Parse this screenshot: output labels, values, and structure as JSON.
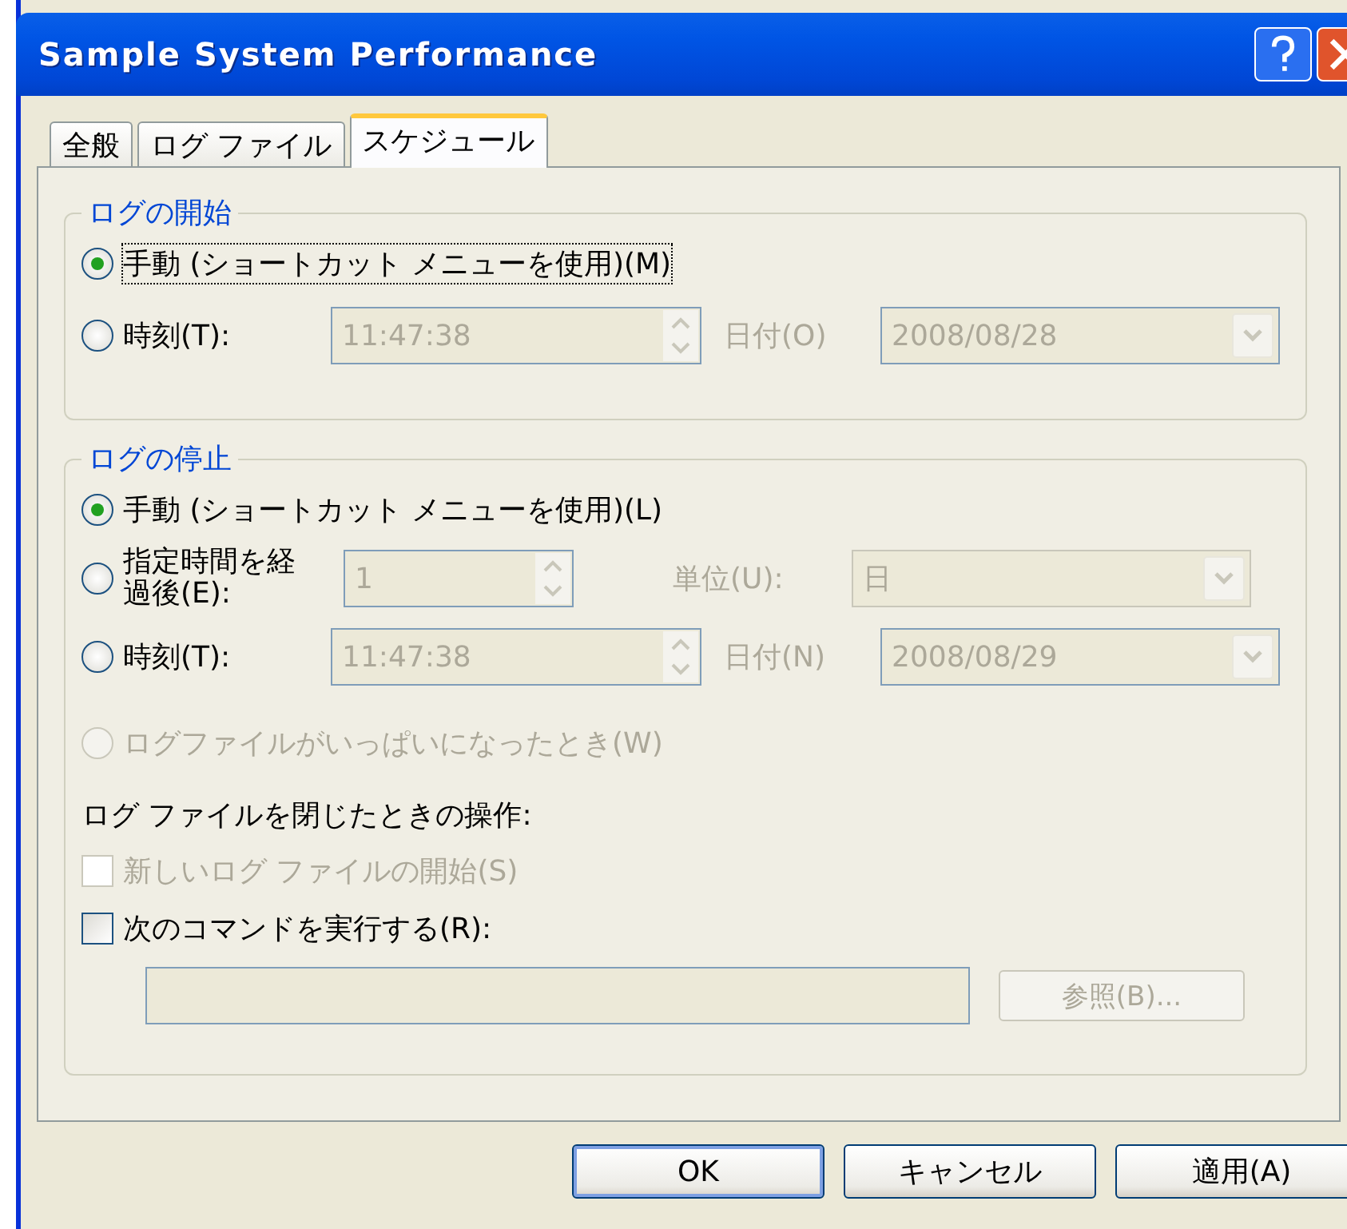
{
  "window": {
    "title": "Sample System Performance"
  },
  "tabs": [
    {
      "label": "全般",
      "selected": false
    },
    {
      "label": "ログ ファイル",
      "selected": false
    },
    {
      "label": "スケジュール",
      "selected": true
    }
  ],
  "start_group": {
    "title": "ログの開始",
    "options": [
      {
        "kind": "radio",
        "label": "手動 (ショートカット メニューを使用)(M)",
        "selected": true,
        "focused": true,
        "disabled": false
      },
      {
        "kind": "time",
        "label": "時刻(T):",
        "selected": false,
        "focused": false,
        "disabled": false,
        "time": "11:47:38",
        "date_label": "日付(O)",
        "date": "2008/08/28"
      }
    ]
  },
  "stop_group": {
    "title": "ログの停止",
    "options": [
      {
        "kind": "radio",
        "label": "手動 (ショートカット メニューを使用)(L)",
        "selected": true,
        "focused": false,
        "disabled": false
      },
      {
        "kind": "elapsed",
        "label": "指定時間を経過後(E):",
        "selected": false,
        "focused": false,
        "disabled": false,
        "value": "1",
        "unit_label": "単位(U):",
        "unit": "日"
      },
      {
        "kind": "time",
        "label": "時刻(T):",
        "selected": false,
        "focused": false,
        "disabled": false,
        "time": "11:47:38",
        "date_label": "日付(N)",
        "date": "2008/08/29"
      },
      {
        "kind": "radio",
        "label": "ログファイルがいっぱいになったとき(W)",
        "selected": false,
        "focused": false,
        "disabled": true
      }
    ]
  },
  "close_action": {
    "heading": "ログ ファイルを閉じたときの操作:",
    "checkboxes": [
      {
        "label": "新しいログ ファイルの開始(S)",
        "checked": false,
        "disabled": true
      },
      {
        "label": "次のコマンドを実行する(R):",
        "checked": false,
        "disabled": false
      }
    ],
    "browse_button": "参照(B)..."
  },
  "buttons": [
    "OK",
    "キャンセル",
    "適用(A)"
  ]
}
